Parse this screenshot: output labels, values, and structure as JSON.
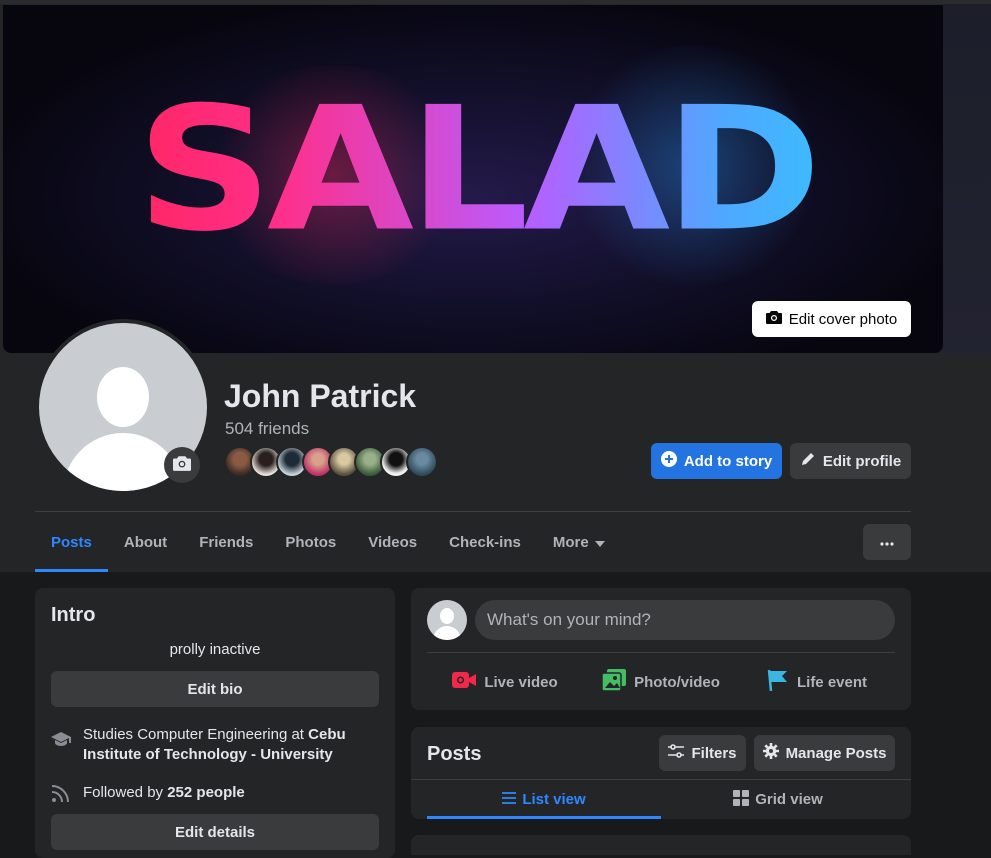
{
  "cover": {
    "text": "SALAD",
    "edit_label": "Edit cover photo"
  },
  "profile": {
    "name": "John Patrick",
    "friends_count": "504 friends",
    "add_story_label": "Add to story",
    "edit_profile_label": "Edit profile"
  },
  "tabs": [
    {
      "label": "Posts"
    },
    {
      "label": "About"
    },
    {
      "label": "Friends"
    },
    {
      "label": "Photos"
    },
    {
      "label": "Videos"
    },
    {
      "label": "Check-ins"
    },
    {
      "label": "More"
    }
  ],
  "intro": {
    "title": "Intro",
    "bio": "prolly inactive",
    "edit_bio_label": "Edit bio",
    "study_prefix": "Studies Computer Engineering at ",
    "study_school": "Cebu Institute of Technology - University",
    "followed_prefix": "Followed by ",
    "followed_count": "252 people",
    "edit_details_label": "Edit details"
  },
  "composer": {
    "placeholder": "What's on your mind?",
    "live_video": "Live video",
    "photo_video": "Photo/video",
    "life_event": "Life event"
  },
  "posts": {
    "title": "Posts",
    "filters_label": "Filters",
    "manage_label": "Manage Posts",
    "list_view_label": "List view",
    "grid_view_label": "Grid view"
  },
  "colors": {
    "accent": "#2d88ff",
    "primary_button": "#2374e1",
    "surface": "#242526",
    "background": "#18191a"
  }
}
